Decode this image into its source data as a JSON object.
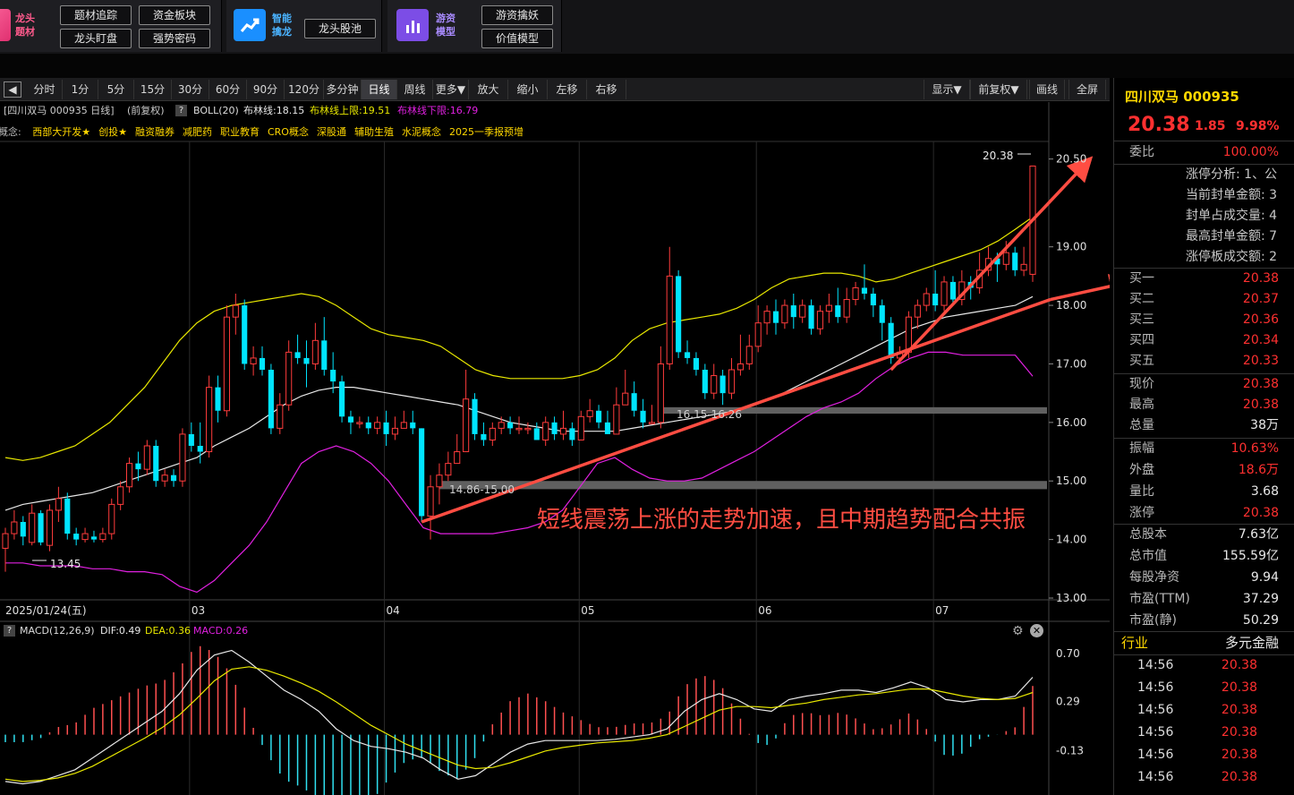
{
  "topbar": {
    "g1_title": [
      "龙头",
      "题材"
    ],
    "g1_buttons": [
      "题材追踪",
      "资金板块",
      "龙头盯盘",
      "强势密码"
    ],
    "g2_title": [
      "智能",
      "擒龙"
    ],
    "g2_button": "龙头股池",
    "g3_title": [
      "游资",
      "模型"
    ],
    "g3_buttons": [
      "游资擒妖",
      "价值模型"
    ]
  },
  "toolbar": {
    "periods": [
      "分时",
      "1分",
      "5分",
      "15分",
      "30分",
      "60分",
      "90分",
      "120分",
      "多分钟",
      "日线",
      "周线",
      "更多▼",
      "放大",
      "缩小",
      "左移",
      "右移"
    ],
    "active": "日线",
    "right": [
      "显示▼",
      "前复权▼",
      "画线",
      "全屏"
    ]
  },
  "info": {
    "title": "[四川双马 000935 日线]",
    "adjust": "(前复权)",
    "help": "?",
    "boll": "BOLL(20)",
    "mid": "布林线:18.15",
    "upper": "布林线上限:19.51",
    "lower": "布林线下限:16.79"
  },
  "concepts": {
    "label": "概念:",
    "items": [
      "西部大开发★",
      "创投★",
      "融资融券",
      "减肥药",
      "职业教育",
      "CRO概念",
      "深股通",
      "辅助生殖",
      "水泥概念",
      "2025一季报预增"
    ]
  },
  "axis": {
    "price_ticks": [
      "20.50",
      "19.00",
      "18.00",
      "17.00",
      "16.00",
      "15.00",
      "14.00",
      "13.00"
    ],
    "date_labels": [
      "2025/01/24(五)",
      "03",
      "04",
      "05",
      "06",
      "07"
    ],
    "macd_ticks": [
      "0.70",
      "0.29",
      "-0.13"
    ]
  },
  "annotations": {
    "max_label": "20.38",
    "min_label": "13.45",
    "zone1": "14.86-15.00",
    "zone2": "16.15-16.26",
    "comment": "短线震荡上涨的走势加速，且中期趋势配合共振"
  },
  "macd_bar": {
    "help": "?",
    "title": "MACD(12,26,9)",
    "dif": "DIF:0.49",
    "dea": "DEA:0.36",
    "macd": "MACD:0.26"
  },
  "right_panel": {
    "stock": "四川双马 000935",
    "price": "20.38",
    "change": "1.85",
    "pct": "9.98%",
    "webi_label": "委比",
    "webi_value": "100.00%",
    "limit_items": [
      "涨停分析: 1、公",
      "当前封单金额: 3",
      "封单占成交量: 4",
      "最高封单金额: 7",
      "涨停板成交额: 2"
    ],
    "bids": [
      {
        "label": "买一",
        "value": "20.38"
      },
      {
        "label": "买二",
        "value": "20.37"
      },
      {
        "label": "买三",
        "value": "20.36"
      },
      {
        "label": "买四",
        "value": "20.34"
      },
      {
        "label": "买五",
        "value": "20.33"
      }
    ],
    "quote": [
      {
        "label": "现价",
        "value": "20.38"
      },
      {
        "label": "最高",
        "value": "20.38"
      },
      {
        "label": "总量",
        "value": "38万"
      }
    ],
    "stats": [
      {
        "label": "振幅",
        "value": "10.63%"
      },
      {
        "label": "外盘",
        "value": "18.6万"
      },
      {
        "label": "量比",
        "value": "3.68"
      },
      {
        "label": "涨停",
        "value": "20.38"
      }
    ],
    "fund": [
      {
        "label": "总股本",
        "value": "7.63亿"
      },
      {
        "label": "总市值",
        "value": "155.59亿"
      },
      {
        "label": "每股净资",
        "value": "9.94"
      },
      {
        "label": "市盈(TTM)",
        "value": "37.29"
      },
      {
        "label": "市盈(静)",
        "value": "50.29"
      }
    ],
    "industry_label": "行业",
    "industry_value": "多元金融",
    "ticks": [
      {
        "time": "14:56",
        "price": "20.38"
      },
      {
        "time": "14:56",
        "price": "20.38"
      },
      {
        "time": "14:56",
        "price": "20.38"
      },
      {
        "time": "14:56",
        "price": "20.38"
      },
      {
        "time": "14:56",
        "price": "20.38"
      },
      {
        "time": "14:56",
        "price": "20.38"
      }
    ]
  },
  "chart_data": {
    "type": "candlestick",
    "ylim": [
      13.0,
      20.8
    ],
    "candles": [
      [
        13.85,
        14.1,
        14.2,
        13.45
      ],
      [
        14.1,
        14.3,
        14.5,
        14.0
      ],
      [
        14.3,
        14.05,
        14.4,
        13.9
      ],
      [
        13.95,
        14.45,
        14.6,
        13.9
      ],
      [
        14.45,
        13.95,
        14.5,
        13.9
      ],
      [
        13.9,
        14.5,
        14.6,
        13.8
      ],
      [
        14.5,
        14.7,
        14.9,
        14.3
      ],
      [
        14.7,
        14.1,
        14.8,
        14.0
      ],
      [
        14.1,
        14.0,
        14.2,
        13.9
      ],
      [
        14.0,
        14.1,
        14.2,
        13.95
      ],
      [
        14.05,
        14.0,
        14.15,
        13.95
      ],
      [
        14.0,
        14.1,
        14.2,
        13.95
      ],
      [
        14.1,
        14.6,
        14.7,
        14.0
      ],
      [
        14.6,
        14.9,
        15.0,
        14.5
      ],
      [
        14.9,
        15.3,
        15.4,
        14.8
      ],
      [
        15.3,
        15.2,
        15.5,
        15.0
      ],
      [
        15.2,
        15.6,
        15.7,
        15.1
      ],
      [
        15.6,
        15.0,
        15.7,
        14.9
      ],
      [
        15.0,
        15.1,
        15.2,
        14.9
      ],
      [
        15.1,
        15.0,
        15.2,
        14.9
      ],
      [
        15.0,
        15.8,
        15.9,
        14.9
      ],
      [
        15.8,
        15.6,
        16.0,
        15.5
      ],
      [
        15.6,
        15.5,
        16.0,
        15.3
      ],
      [
        15.5,
        16.6,
        16.8,
        15.4
      ],
      [
        16.6,
        16.2,
        16.8,
        16.0
      ],
      [
        16.2,
        17.8,
        18.0,
        16.1
      ],
      [
        17.8,
        18.0,
        18.2,
        17.5
      ],
      [
        18.0,
        17.0,
        18.1,
        16.9
      ],
      [
        17.0,
        17.1,
        17.3,
        16.8
      ],
      [
        17.1,
        16.9,
        17.3,
        16.8
      ],
      [
        16.9,
        15.9,
        17.0,
        15.8
      ],
      [
        15.9,
        16.3,
        16.5,
        15.8
      ],
      [
        16.3,
        17.2,
        17.4,
        16.2
      ],
      [
        17.2,
        17.1,
        17.5,
        17.0
      ],
      [
        17.1,
        17.0,
        17.4,
        16.6
      ],
      [
        17.0,
        17.4,
        17.7,
        16.9
      ],
      [
        17.4,
        16.9,
        17.8,
        16.8
      ],
      [
        16.9,
        16.7,
        17.2,
        16.5
      ],
      [
        16.7,
        16.1,
        16.8,
        16.0
      ],
      [
        16.1,
        16.0,
        16.2,
        15.8
      ],
      [
        16.0,
        16.0,
        16.1,
        15.9
      ],
      [
        16.0,
        15.9,
        16.1,
        15.8
      ],
      [
        15.9,
        16.0,
        16.1,
        15.8
      ],
      [
        16.0,
        15.8,
        16.2,
        15.6
      ],
      [
        15.8,
        15.9,
        16.1,
        15.7
      ],
      [
        15.9,
        16.0,
        16.2,
        15.9
      ],
      [
        16.0,
        15.9,
        16.2,
        15.8
      ],
      [
        15.9,
        14.4,
        15.9,
        14.3
      ],
      [
        14.4,
        14.9,
        15.1,
        14.0
      ],
      [
        14.9,
        15.1,
        15.3,
        14.6
      ],
      [
        15.1,
        15.3,
        15.5,
        15.0
      ],
      [
        15.3,
        15.5,
        15.8,
        15.3
      ],
      [
        15.5,
        16.4,
        16.9,
        15.5
      ],
      [
        16.4,
        15.8,
        16.5,
        15.7
      ],
      [
        15.8,
        15.7,
        16.0,
        15.6
      ],
      [
        15.7,
        15.9,
        16.0,
        15.6
      ],
      [
        15.9,
        16.0,
        16.1,
        15.8
      ],
      [
        16.0,
        15.9,
        16.1,
        15.8
      ],
      [
        15.9,
        15.9,
        16.1,
        15.8
      ],
      [
        15.9,
        15.9,
        16.0,
        15.8
      ],
      [
        15.9,
        15.7,
        16.0,
        15.7
      ],
      [
        15.7,
        16.0,
        16.1,
        15.6
      ],
      [
        16.0,
        15.8,
        16.1,
        15.7
      ],
      [
        15.8,
        15.9,
        16.2,
        15.7
      ],
      [
        15.9,
        15.7,
        16.0,
        15.6
      ],
      [
        15.7,
        16.1,
        16.2,
        15.7
      ],
      [
        16.1,
        16.2,
        16.4,
        16.0
      ],
      [
        16.2,
        16.0,
        16.3,
        15.9
      ],
      [
        16.0,
        15.8,
        16.2,
        15.8
      ],
      [
        15.8,
        16.3,
        16.6,
        15.8
      ],
      [
        16.3,
        16.5,
        16.9,
        16.3
      ],
      [
        16.5,
        16.2,
        16.7,
        16.1
      ],
      [
        16.2,
        16.0,
        16.4,
        15.9
      ],
      [
        16.0,
        16.0,
        16.3,
        16.0
      ],
      [
        16.0,
        17.0,
        17.3,
        15.9
      ],
      [
        17.0,
        18.5,
        19.0,
        16.9
      ],
      [
        18.5,
        17.2,
        18.6,
        17.1
      ],
      [
        17.2,
        17.1,
        17.4,
        17.0
      ],
      [
        17.1,
        16.9,
        17.2,
        16.8
      ],
      [
        16.9,
        16.5,
        17.0,
        16.4
      ],
      [
        16.5,
        16.8,
        17.0,
        16.4
      ],
      [
        16.8,
        16.5,
        16.9,
        16.3
      ],
      [
        16.5,
        16.9,
        17.1,
        16.4
      ],
      [
        16.9,
        17.0,
        17.5,
        16.8
      ],
      [
        17.0,
        17.3,
        17.5,
        16.9
      ],
      [
        17.3,
        17.7,
        18.0,
        17.2
      ],
      [
        17.7,
        17.9,
        18.0,
        17.5
      ],
      [
        17.9,
        17.7,
        18.1,
        17.5
      ],
      [
        17.7,
        18.0,
        18.1,
        17.6
      ],
      [
        18.0,
        17.8,
        18.2,
        17.6
      ],
      [
        17.8,
        18.0,
        18.1,
        17.7
      ],
      [
        18.0,
        17.6,
        18.1,
        17.5
      ],
      [
        17.6,
        17.9,
        18.0,
        17.5
      ],
      [
        17.9,
        18.0,
        18.2,
        17.7
      ],
      [
        18.0,
        17.8,
        18.3,
        17.7
      ],
      [
        17.8,
        18.1,
        18.3,
        17.7
      ],
      [
        18.1,
        18.3,
        18.4,
        18.0
      ],
      [
        18.3,
        18.2,
        18.7,
        18.1
      ],
      [
        18.2,
        18.0,
        18.3,
        17.8
      ],
      [
        18.0,
        17.7,
        18.1,
        17.4
      ],
      [
        17.7,
        17.1,
        17.8,
        17.0
      ],
      [
        17.1,
        17.2,
        17.3,
        17.0
      ],
      [
        17.2,
        17.8,
        17.9,
        17.1
      ],
      [
        17.8,
        18.0,
        18.1,
        17.6
      ],
      [
        18.0,
        18.2,
        18.3,
        17.9
      ],
      [
        18.2,
        18.0,
        18.6,
        17.9
      ],
      [
        18.0,
        18.4,
        18.5,
        17.9
      ],
      [
        18.4,
        18.1,
        18.5,
        18.0
      ],
      [
        18.1,
        18.4,
        18.6,
        18.0
      ],
      [
        18.4,
        18.3,
        18.5,
        18.1
      ],
      [
        18.3,
        18.6,
        18.9,
        18.2
      ],
      [
        18.6,
        18.8,
        19.0,
        18.5
      ],
      [
        18.8,
        18.7,
        18.9,
        18.4
      ],
      [
        18.7,
        18.9,
        19.1,
        18.6
      ],
      [
        18.9,
        18.6,
        19.0,
        18.5
      ],
      [
        18.6,
        18.7,
        19.0,
        18.5
      ],
      [
        18.53,
        20.38,
        20.38,
        18.4
      ]
    ],
    "boll_mid": [
      14.5,
      14.6,
      14.65,
      14.7,
      14.75,
      14.8,
      14.9,
      15.0,
      15.1,
      15.2,
      15.3,
      15.4,
      15.6,
      15.75,
      15.9,
      16.1,
      16.3,
      16.45,
      16.55,
      16.6,
      16.6,
      16.55,
      16.5,
      16.45,
      16.4,
      16.35,
      16.3,
      16.2,
      16.1,
      16.0,
      15.95,
      15.9,
      15.85,
      15.85,
      15.85,
      15.85,
      15.9,
      15.95,
      16.0,
      16.05,
      16.1,
      16.15,
      16.2,
      16.3,
      16.4,
      16.55,
      16.7,
      16.85,
      17.0,
      17.15,
      17.3,
      17.45,
      17.6,
      17.7,
      17.8,
      17.85,
      17.9,
      17.95,
      18.0,
      18.15
    ],
    "boll_upper": [
      15.4,
      15.35,
      15.4,
      15.5,
      15.6,
      15.8,
      16.0,
      16.3,
      16.6,
      17.0,
      17.4,
      17.7,
      17.9,
      18.0,
      18.05,
      18.1,
      18.15,
      18.2,
      18.15,
      18.0,
      17.8,
      17.6,
      17.5,
      17.45,
      17.4,
      17.3,
      17.1,
      16.9,
      16.8,
      16.75,
      16.75,
      16.75,
      16.75,
      16.8,
      16.9,
      17.1,
      17.4,
      17.6,
      17.7,
      17.75,
      17.8,
      17.85,
      17.95,
      18.1,
      18.3,
      18.45,
      18.5,
      18.55,
      18.55,
      18.5,
      18.4,
      18.45,
      18.55,
      18.65,
      18.75,
      18.85,
      18.95,
      19.1,
      19.3,
      19.51
    ],
    "boll_lower": [
      13.6,
      13.6,
      13.55,
      13.55,
      13.55,
      13.5,
      13.5,
      13.45,
      13.45,
      13.4,
      13.2,
      13.1,
      13.3,
      13.6,
      13.9,
      14.3,
      14.8,
      15.3,
      15.5,
      15.6,
      15.5,
      15.3,
      15.0,
      14.6,
      14.2,
      14.1,
      14.1,
      14.1,
      14.1,
      14.15,
      14.2,
      14.3,
      14.5,
      14.9,
      15.3,
      15.4,
      15.2,
      15.05,
      15.0,
      15.0,
      15.05,
      15.2,
      15.35,
      15.5,
      15.7,
      15.9,
      16.1,
      16.25,
      16.35,
      16.5,
      16.75,
      16.95,
      17.1,
      17.2,
      17.2,
      17.15,
      17.15,
      17.15,
      17.15,
      16.79
    ],
    "macd_dif": [
      -0.4,
      -0.42,
      -0.4,
      -0.35,
      -0.3,
      -0.2,
      -0.1,
      0.0,
      0.1,
      0.2,
      0.35,
      0.55,
      0.68,
      0.72,
      0.62,
      0.5,
      0.38,
      0.3,
      0.2,
      0.05,
      -0.05,
      -0.1,
      -0.12,
      -0.15,
      -0.2,
      -0.3,
      -0.38,
      -0.35,
      -0.25,
      -0.15,
      -0.08,
      -0.05,
      -0.05,
      -0.05,
      -0.05,
      -0.04,
      -0.02,
      0.0,
      0.05,
      0.2,
      0.3,
      0.35,
      0.3,
      0.22,
      0.2,
      0.3,
      0.33,
      0.35,
      0.38,
      0.38,
      0.36,
      0.4,
      0.45,
      0.4,
      0.3,
      0.28,
      0.3,
      0.3,
      0.33,
      0.49
    ],
    "macd_dea": [
      -0.38,
      -0.4,
      -0.39,
      -0.37,
      -0.33,
      -0.27,
      -0.19,
      -0.11,
      -0.03,
      0.06,
      0.17,
      0.31,
      0.46,
      0.56,
      0.58,
      0.55,
      0.5,
      0.44,
      0.37,
      0.28,
      0.18,
      0.08,
      0.0,
      -0.08,
      -0.14,
      -0.2,
      -0.26,
      -0.29,
      -0.28,
      -0.24,
      -0.19,
      -0.14,
      -0.11,
      -0.09,
      -0.07,
      -0.06,
      -0.05,
      -0.03,
      0.0,
      0.07,
      0.14,
      0.21,
      0.24,
      0.24,
      0.23,
      0.25,
      0.27,
      0.3,
      0.32,
      0.34,
      0.35,
      0.37,
      0.39,
      0.39,
      0.36,
      0.33,
      0.31,
      0.3,
      0.31,
      0.36
    ],
    "trend_lines": [
      {
        "from": [
          47,
          14.3
        ],
        "to": [
          118,
          18.1
        ]
      },
      {
        "from": [
          100,
          16.9
        ],
        "to": [
          115,
          19.3
        ]
      },
      {
        "from": [
          118,
          18.1
        ],
        "to": [
          124,
          18.2
        ]
      },
      {
        "from": [
          115,
          19.3
        ],
        "to": [
          121,
          20.3
        ]
      }
    ],
    "support_zones": [
      [
        14.86,
        15.0
      ],
      [
        16.15,
        16.26
      ]
    ]
  }
}
